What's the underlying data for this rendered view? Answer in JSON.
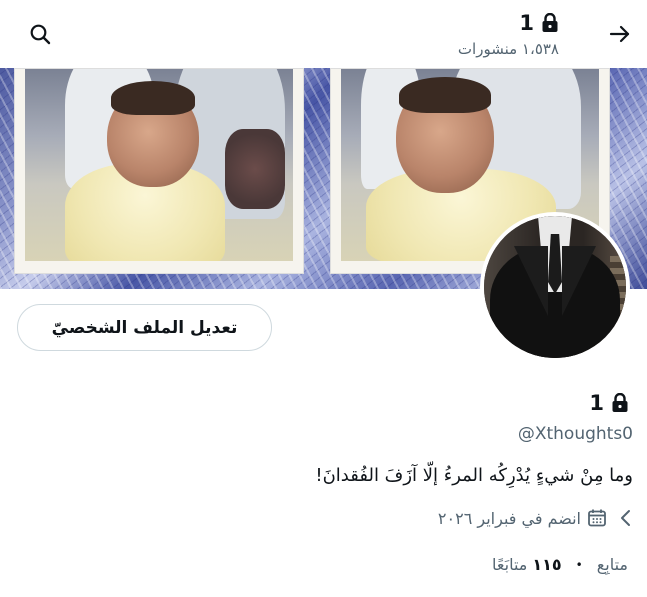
{
  "header": {
    "title": "1",
    "posts_count": "١،٥٣٨",
    "posts_label": "منشورات",
    "icons": {
      "back": "arrow-right-icon",
      "search": "search-icon",
      "lock": "lock-icon"
    }
  },
  "banner": {
    "description_icon": "banner-photo"
  },
  "profile": {
    "edit_button_label": "تعديل الملف الشخصيّ",
    "display_name": "1",
    "handle": "@Xthoughts0",
    "bio": "وما مِنْ شيءٍ يُدْرِكُه المرءُ إلّا آزَفَ الفُقدانَ!",
    "joined_text": "انضم في فبراير ٢٠٢٦",
    "following_count": "١١٥",
    "following_label": "متابَعًا",
    "followers_count": "",
    "followers_label": "متابِع"
  },
  "colors": {
    "text_primary": "#0f1419",
    "text_secondary": "#536471",
    "border": "#cfd9de"
  }
}
